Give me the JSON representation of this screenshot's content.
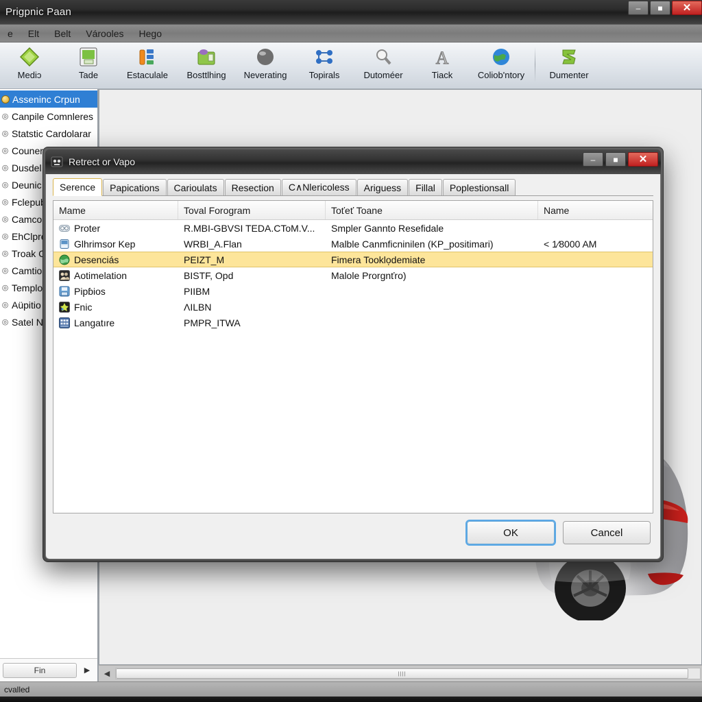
{
  "app": {
    "title": "Prigpnic Paan",
    "window_buttons": [
      {
        "name": "minimize",
        "glyph": "–"
      },
      {
        "name": "maximize",
        "glyph": "■"
      },
      {
        "name": "close",
        "glyph": "✕"
      }
    ],
    "menu": [
      "e",
      "Elt",
      "Belt",
      "Várooles",
      "Hego"
    ],
    "toolbar": [
      {
        "label": "Mediɔ",
        "icon": "green-diamond-icon"
      },
      {
        "label": "Tade",
        "icon": "green-document-icon"
      },
      {
        "label": "Estaculale",
        "icon": "orange-blue-chart-icon"
      },
      {
        "label": "Bosttlhing",
        "icon": "green-folder-icon"
      },
      {
        "label": "Neverating",
        "icon": "gray-sphere-icon"
      },
      {
        "label": "Topirals",
        "icon": "blue-network-icon"
      },
      {
        "label": "Dutoméer",
        "icon": "magnifier-icon"
      },
      {
        "label": "Tiack",
        "icon": "letter-a-icon"
      },
      {
        "label": "Coliob'ntory",
        "icon": "globe-icon"
      },
      {
        "separator": true
      },
      {
        "label": "Dumenter",
        "icon": "green-z-icon"
      }
    ],
    "sidebar": {
      "items": [
        {
          "label": "Asseninc Crpun",
          "selected": true
        },
        {
          "label": "Canpile Comnleres",
          "selected": false
        },
        {
          "label": "Statstic Cardolarar",
          "selected": false
        },
        {
          "label": "Couner",
          "selected": false
        },
        {
          "label": "Dusdel",
          "selected": false
        },
        {
          "label": "Deunic",
          "selected": false
        },
        {
          "label": "Fclepub",
          "selected": false
        },
        {
          "label": "Camco",
          "selected": false
        },
        {
          "label": "EhClpre",
          "selected": false
        },
        {
          "label": "Troak C",
          "selected": false
        },
        {
          "label": "Camtio",
          "selected": false
        },
        {
          "label": "Templo",
          "selected": false
        },
        {
          "label": "Aüpitio",
          "selected": false
        },
        {
          "label": "Satel N",
          "selected": false
        }
      ],
      "footer_button": "Fin",
      "footer_arrow": "▶"
    },
    "scroll": {
      "left_arrow": "◀",
      "right_arrow": "▶"
    },
    "statusbar": "cvalled"
  },
  "dialog": {
    "title": "Retrect or Vapo",
    "window_buttons": [
      {
        "name": "minimize",
        "glyph": "–"
      },
      {
        "name": "maximize",
        "glyph": "■"
      },
      {
        "name": "close",
        "glyph": "✕"
      }
    ],
    "tabs": [
      {
        "label": "Serence",
        "active": true
      },
      {
        "label": "Papications",
        "active": false
      },
      {
        "label": "Carioulats",
        "active": false
      },
      {
        "label": "Resection",
        "active": false
      },
      {
        "label": "C∧Nlericoless",
        "active": false
      },
      {
        "label": "Ariguess",
        "active": false
      },
      {
        "label": "Fillal",
        "active": false
      },
      {
        "label": "Poplestionsall",
        "active": false
      }
    ],
    "list": {
      "columns": [
        "Mame",
        "Toval Forogram",
        "Toťeť Toane",
        "Name"
      ],
      "rows": [
        {
          "icon": "glasses-icon",
          "icon_color": "#d6dde4",
          "name": "Proter",
          "program": "R.MBI-GBVSI TEDA.CToM.V...",
          "toane": "Smpler Gannto Resefidale",
          "extra": "",
          "selected": false
        },
        {
          "icon": "monitor-icon",
          "icon_color": "#8fb8dd",
          "name": "Glhrimsor Kep",
          "program": "WRBI_A.Flan",
          "toane": "Malble Canmficninilen (KP_positimari)",
          "extra": "< 1⁄8000 AM",
          "selected": false
        },
        {
          "icon": "green-globe-icon",
          "icon_color": "#3fa04a",
          "name": "Desenciás",
          "program": "PEIZT_M",
          "toane": "Fimera Tooklo̦demiate",
          "extra": "",
          "selected": true
        },
        {
          "icon": "people-icon",
          "icon_color": "#c7b79a",
          "name": "Aotimelation",
          "program": "BISTF, Opd",
          "toane": "Malole Prorgnťro)",
          "extra": "",
          "selected": false
        },
        {
          "icon": "save-disk-icon",
          "icon_color": "#6fa7d8",
          "name": "Pipɓios",
          "program": "PIIBM",
          "toane": "",
          "extra": "",
          "selected": false
        },
        {
          "icon": "dark-star-icon",
          "icon_color": "#2b2b2b",
          "name": "Fnic",
          "program": "ΛILBN",
          "toane": "",
          "extra": "",
          "selected": false
        },
        {
          "icon": "blue-grid-icon",
          "icon_color": "#4a6fa5",
          "name": "Langatıre",
          "program": "PMPR_ITWA",
          "toane": "",
          "extra": "",
          "selected": false
        }
      ]
    },
    "buttons": {
      "ok": "OK",
      "cancel": "Cancel"
    }
  },
  "colors": {
    "selection_blue": "#2f7fd4",
    "row_highlight": "#fde59a",
    "close_red": "#bf2020",
    "focus_ring": "#5aa8e6"
  }
}
